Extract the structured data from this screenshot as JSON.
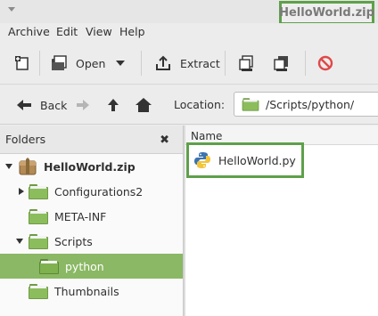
{
  "window": {
    "title": "HelloWorld.zip"
  },
  "menubar": {
    "items": [
      "Archive",
      "Edit",
      "View",
      "Help"
    ]
  },
  "toolbar": {
    "open_label": "Open",
    "extract_label": "Extract",
    "icons": [
      "new-archive-icon",
      "open-archive-icon",
      "extract-icon",
      "add-files-icon",
      "add-folder-icon",
      "stop-icon"
    ]
  },
  "navigation": {
    "back_label": "Back",
    "location_label": "Location:",
    "location_value": "/Scripts/python/"
  },
  "sidebar": {
    "header": "Folders",
    "close_glyph": "✖",
    "tree": [
      {
        "label": "HelloWorld.zip",
        "expander": "expanded",
        "icon": "archive-icon"
      },
      {
        "label": "Configurations2",
        "expander": "collapsed",
        "icon": "folder-icon"
      },
      {
        "label": "META-INF",
        "expander": "none",
        "icon": "folder-icon"
      },
      {
        "label": "Scripts",
        "expander": "expanded",
        "icon": "folder-icon"
      },
      {
        "label": "python",
        "expander": "none",
        "icon": "folder-icon",
        "selected": true
      },
      {
        "label": "Thumbnails",
        "expander": "none",
        "icon": "folder-icon"
      }
    ]
  },
  "filelist": {
    "column_name": "Name",
    "files": [
      {
        "name": "HelloWorld.py",
        "icon": "python-file-icon"
      }
    ]
  },
  "colors": {
    "highlight_green": "#5ea04a",
    "selection": "#8ab864",
    "folder_green": "#8cbd5d",
    "stop_red": "#e04848"
  }
}
